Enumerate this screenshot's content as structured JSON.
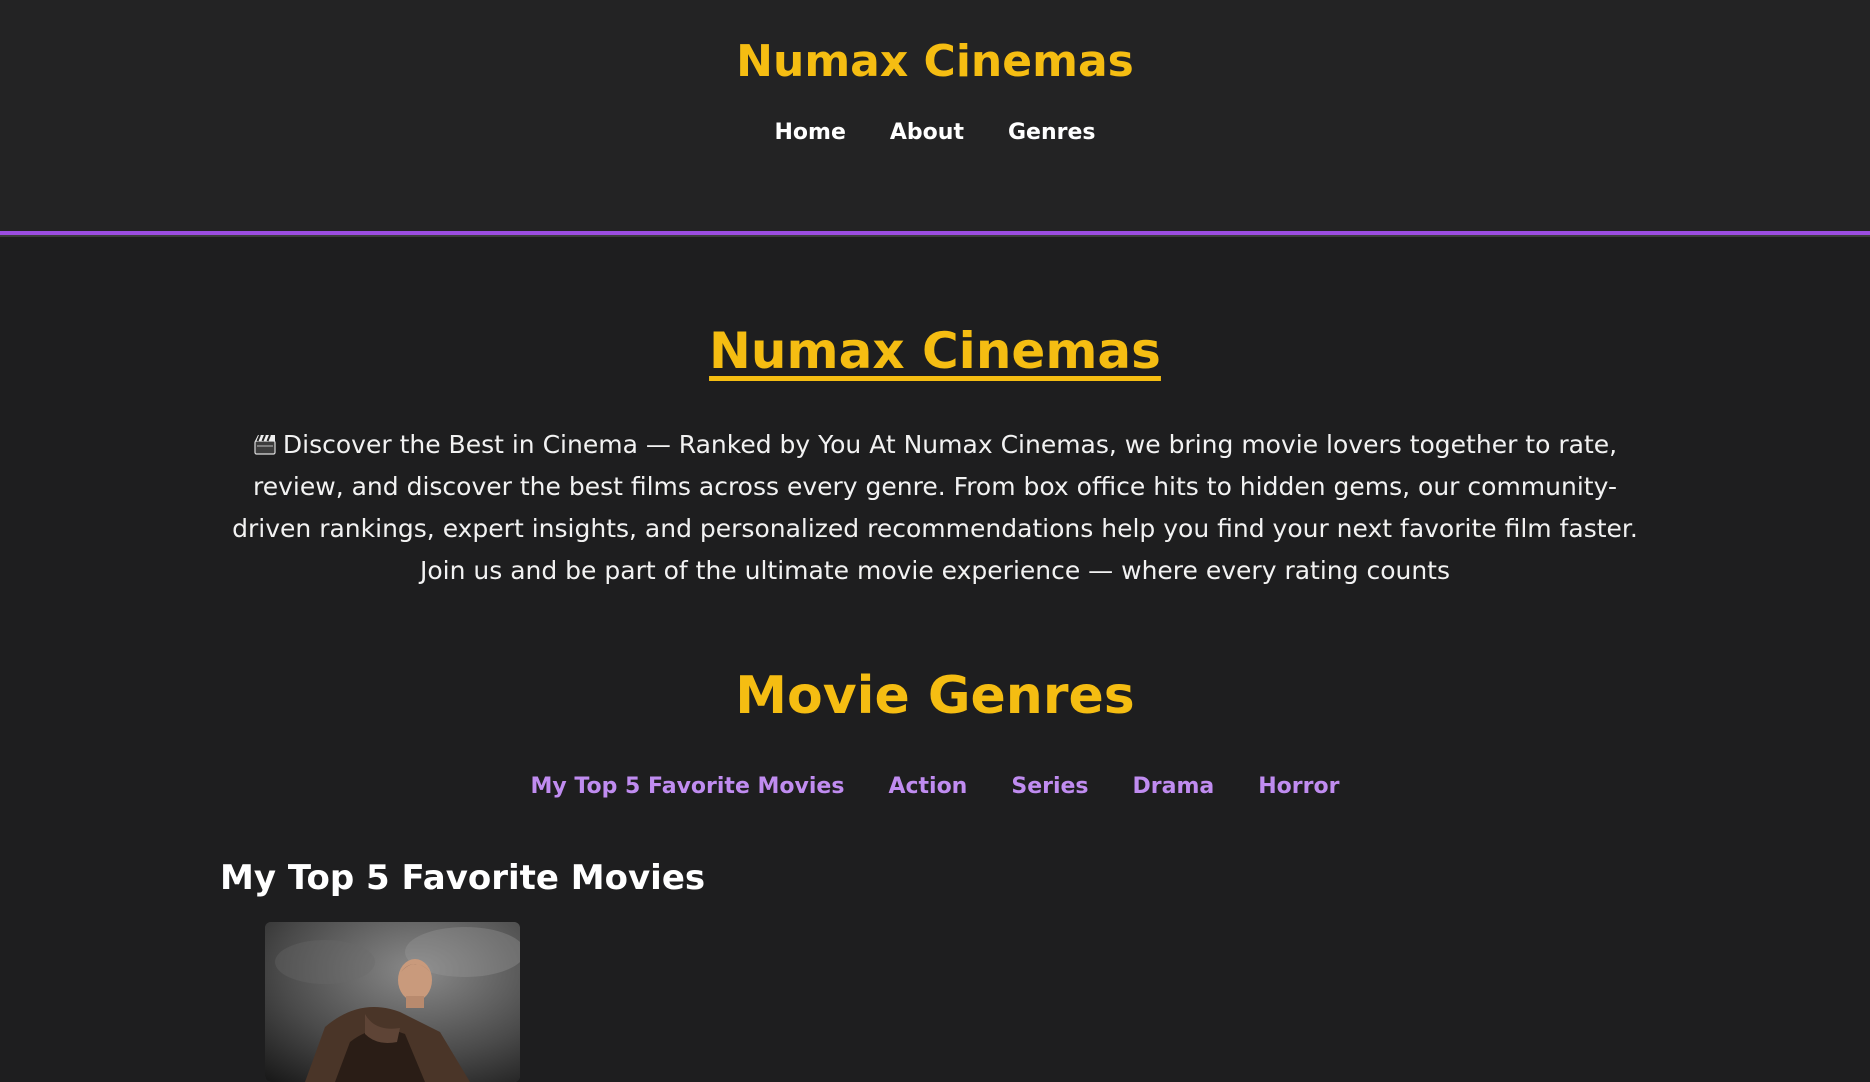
{
  "header": {
    "logo": "Numax Cinemas",
    "nav": [
      "Home",
      "About",
      "Genres"
    ]
  },
  "hero": {
    "title": "Numax Cinemas",
    "intro_icon": "clapperboard-icon",
    "intro": "Discover the Best in Cinema — Ranked by You At Numax Cinemas, we bring movie lovers together to rate, review, and discover the best films across every genre. From box office hits to hidden gems, our community-driven rankings, expert insights, and personalized recommendations help you find your next favorite film faster. Join us and be part of the ultimate movie experience — where every rating counts"
  },
  "genres": {
    "title": "Movie Genres",
    "links": [
      "My Top 5 Favorite Movies",
      "Action",
      "Series",
      "Drama",
      "Horror"
    ]
  },
  "section": {
    "heading": "My Top 5 Favorite Movies"
  },
  "colors": {
    "accent_yellow": "#f5bd12",
    "accent_purple": "#9b4de0",
    "link_purple": "#c08cf0",
    "background": "#1e1e1f"
  }
}
